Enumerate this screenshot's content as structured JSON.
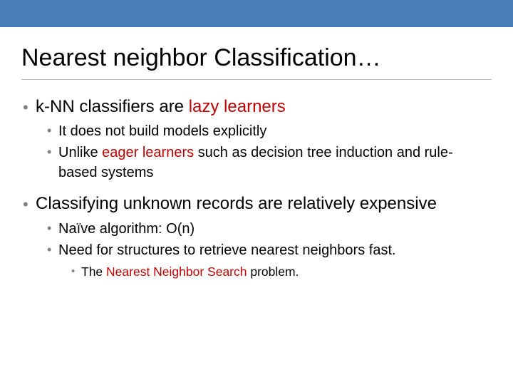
{
  "accent_bar_color": "#4a7ebb",
  "title": "Nearest neighbor Classification…",
  "bullets": {
    "b1_pre": "k-NN classifiers are ",
    "b1_hl": "lazy learners",
    "s1a": "It does not build models explicitly",
    "s1b_pre": "Unlike ",
    "s1b_hl": "eager learners",
    "s1b_post": " such as decision tree induction and rule-based systems",
    "b2": "Classifying unknown records are relatively expensive",
    "s2a": "Naïve algorithm: O(n)",
    "s2b": "Need for structures to retrieve nearest neighbors fast.",
    "s2b_i_pre": "The ",
    "s2b_i_hl": "Nearest Neighbor Search",
    "s2b_i_post": " problem."
  }
}
